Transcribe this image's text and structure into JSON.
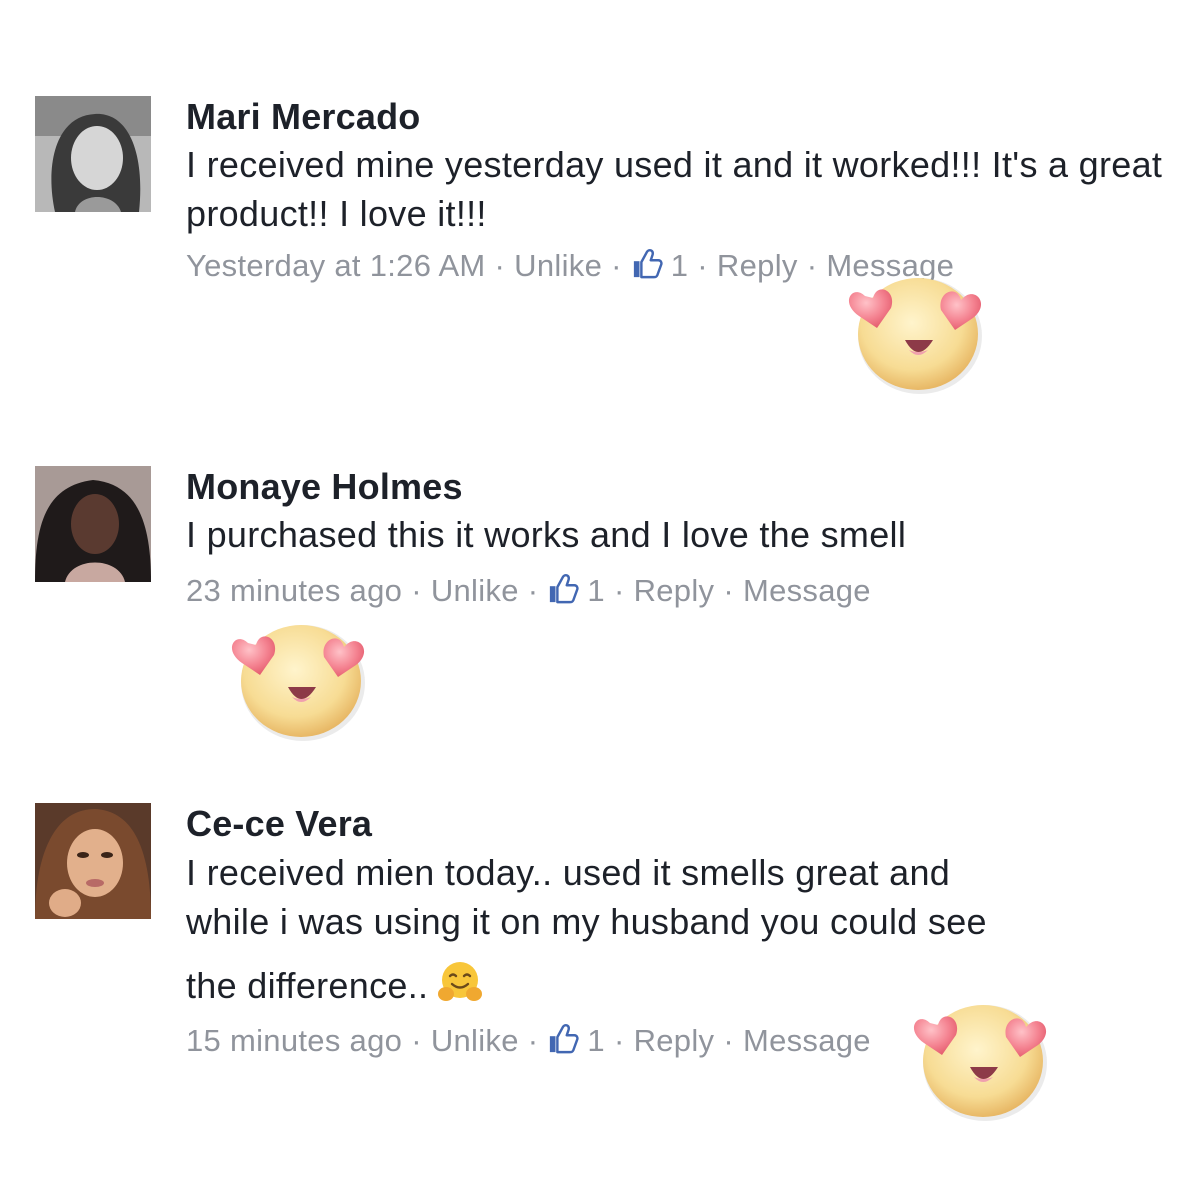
{
  "comments": [
    {
      "author": "Mari Mercado",
      "text": "I received mine yesterday used it and it worked!!! It's a great product!! I love it!!!",
      "timestamp": "Yesterday at 1:26 AM",
      "unlike_label": "Unlike",
      "like_count": "1",
      "reply_label": "Reply",
      "message_label": "Message"
    },
    {
      "author": "Monaye Holmes",
      "text": "I purchased this it works and I love the smell",
      "timestamp": "23 minutes ago",
      "unlike_label": "Unlike",
      "like_count": "1",
      "reply_label": "Reply",
      "message_label": "Message"
    },
    {
      "author": "Ce-ce Vera",
      "text_line1": "I received mien today.. used it smells great and",
      "text_line2": "while i was using it on my husband you could see",
      "text_line3": "the difference..",
      "timestamp": "15 minutes ago",
      "unlike_label": "Unlike",
      "like_count": "1",
      "reply_label": "Reply",
      "message_label": "Message"
    }
  ],
  "separator": "·",
  "icons": {
    "like": "thumbs-up-icon",
    "overlay": "heart-eyes-emoji",
    "inline": "hugging-face-emoji"
  },
  "colors": {
    "name": "#1d2129",
    "body": "#1d2129",
    "meta": "#90949c",
    "like_blue": "#4267b2",
    "emoji_face": "#f9d98a",
    "emoji_heart": "#f07a8a"
  }
}
